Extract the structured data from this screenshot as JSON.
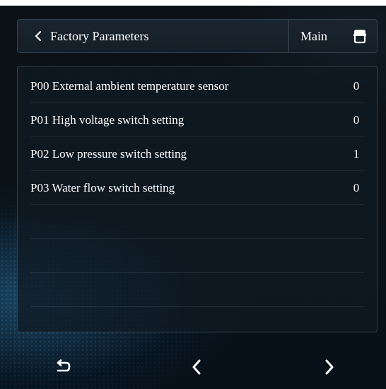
{
  "header": {
    "title": "Factory Parameters",
    "main_label": "Main",
    "back_icon": "chevron-left-icon",
    "home_icon": "home-icon"
  },
  "parameters": [
    {
      "label": "P00 External ambient temperature sensor",
      "value": "0"
    },
    {
      "label": "P01 High voltage switch setting",
      "value": "0"
    },
    {
      "label": "P02 Low pressure switch setting",
      "value": "1"
    },
    {
      "label": "P03 Water flow switch setting",
      "value": "0"
    }
  ],
  "nav": {
    "return_icon": "return-icon",
    "prev_icon": "chevron-left-icon",
    "next_icon": "chevron-right-icon"
  },
  "colors": {
    "text": "#ffffff",
    "panel_border": "#2f3f4c",
    "background": "#0a1218"
  }
}
